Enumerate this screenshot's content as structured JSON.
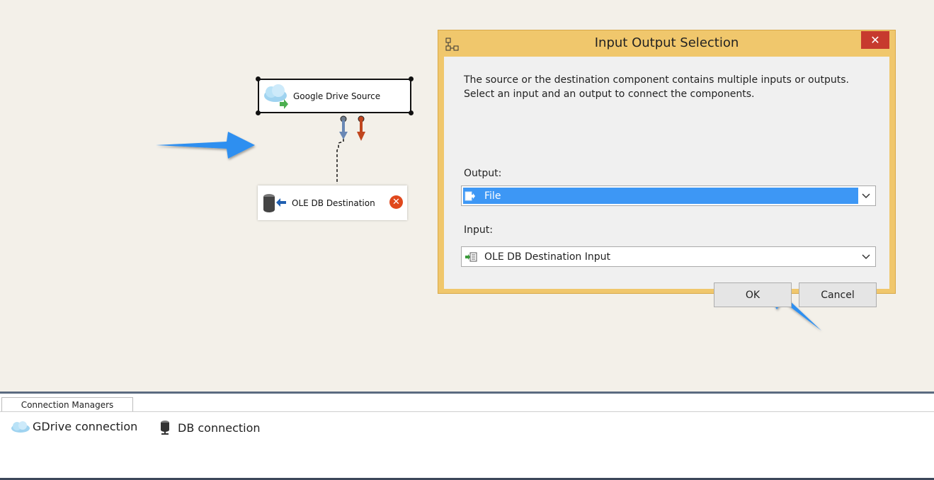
{
  "canvas": {
    "source_component": {
      "label": "Google Drive Source",
      "icon": "cloud-source-icon"
    },
    "destination_component": {
      "label": "OLE DB Destination",
      "icon": "database-destination-icon",
      "error_icon": "error-icon"
    }
  },
  "dialog": {
    "title": "Input Output Selection",
    "close_label": "✕",
    "description": "The source or the destination component contains multiple inputs or outputs. Select an input and an output to connect the components.",
    "output_label": "Output:",
    "output_value": "File",
    "input_label": "Input:",
    "input_value": "OLE DB Destination Input",
    "ok_label": "OK",
    "cancel_label": "Cancel"
  },
  "connection_managers": {
    "tab_label": "Connection Managers",
    "items": [
      {
        "label": "GDrive connection",
        "icon": "cloud-icon"
      },
      {
        "label": "DB connection",
        "icon": "database-icon"
      }
    ]
  },
  "colors": {
    "arrow": "#2f8ff0",
    "selection": "#3d97f5",
    "dialog_frame": "#f0c76c",
    "close": "#c73a2e"
  }
}
